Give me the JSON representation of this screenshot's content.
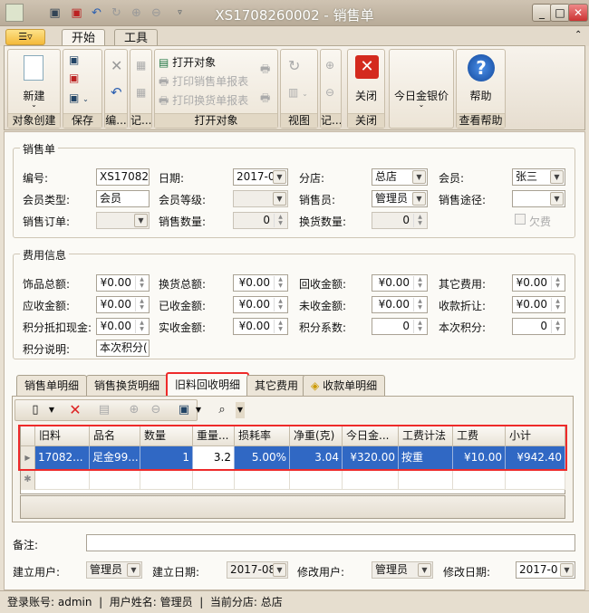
{
  "window": {
    "title": "XS1708260002 - 销售单"
  },
  "ribbon": {
    "tabs": [
      "开始",
      "工具"
    ],
    "new_label": "新建",
    "open_object": "打开对象",
    "print_sales": "打印销售单报表",
    "print_exchange": "打印换货单报表",
    "close_label": "关闭",
    "gold_price_label": "今日金银价",
    "help_label": "帮助",
    "groups": [
      "对象创建",
      "保存",
      "编...",
      "记...",
      "打开对象",
      "视图",
      "记...",
      "关闭",
      "",
      "查看帮助"
    ]
  },
  "sales": {
    "title": "销售单",
    "fields": [
      {
        "label": "编号:",
        "value": "XS170826"
      },
      {
        "label": "日期:",
        "value": "2017-0"
      },
      {
        "label": "分店:",
        "value": "总店"
      },
      {
        "label": "会员:",
        "value": "张三"
      },
      {
        "label": "会员类型:",
        "value": "会员"
      },
      {
        "label": "会员等级:",
        "value": ""
      },
      {
        "label": "销售员:",
        "value": "管理员"
      },
      {
        "label": "销售途径:",
        "value": ""
      },
      {
        "label": "销售订单:",
        "value": ""
      },
      {
        "label": "销售数量:",
        "value": "0"
      },
      {
        "label": "换货数量:",
        "value": "0"
      },
      {
        "label": "欠费",
        "value": false
      }
    ]
  },
  "fees": {
    "title": "费用信息",
    "fields": [
      {
        "label": "饰品总额:",
        "value": "¥0.00"
      },
      {
        "label": "换货总额:",
        "value": "¥0.00"
      },
      {
        "label": "回收金额:",
        "value": "¥0.00"
      },
      {
        "label": "其它费用:",
        "value": "¥0.00"
      },
      {
        "label": "应收金额:",
        "value": "¥0.00"
      },
      {
        "label": "已收金额:",
        "value": "¥0.00"
      },
      {
        "label": "未收金额:",
        "value": "¥0.00"
      },
      {
        "label": "收款折让:",
        "value": "¥0.00"
      },
      {
        "label": "积分抵扣现金:",
        "value": "¥0.00"
      },
      {
        "label": "实收金额:",
        "value": "¥0.00"
      },
      {
        "label": "积分系数:",
        "value": "0"
      },
      {
        "label": "本次积分:",
        "value": "0"
      },
      {
        "label": "积分说明:",
        "value": "本次积分("
      }
    ]
  },
  "detail_tabs": [
    "销售单明细",
    "销售换货明细",
    "旧料回收明细",
    "其它费用",
    "收款单明细"
  ],
  "active_tab": "旧料回收明细",
  "grid": {
    "columns": [
      "旧料",
      "品名",
      "数量",
      "重量...",
      "损耗率",
      "净重(克)",
      "今日金...",
      "工费计法",
      "工费",
      "小计"
    ],
    "rows": [
      [
        "17082...",
        "足金99...",
        "1",
        "3.2",
        "5.00%",
        "3.04",
        "¥320.00",
        "按重",
        "¥10.00",
        "¥942.40"
      ]
    ]
  },
  "footer": {
    "remark_label": "备注:",
    "remark_value": "",
    "creator_label": "建立用户:",
    "creator": "管理员",
    "created_label": "建立日期:",
    "created": "2017-08",
    "modifier_label": "修改用户:",
    "modifier": "管理员",
    "modified_label": "修改日期:",
    "modified": "2017-0"
  },
  "status": {
    "text": "登录账号: admin  |  用户姓名: 管理员  |  当前分店: 总店"
  },
  "colors": {
    "selection": "#3068c4",
    "highlight": "#ee2a2a",
    "frame": "#c2b6a4"
  }
}
